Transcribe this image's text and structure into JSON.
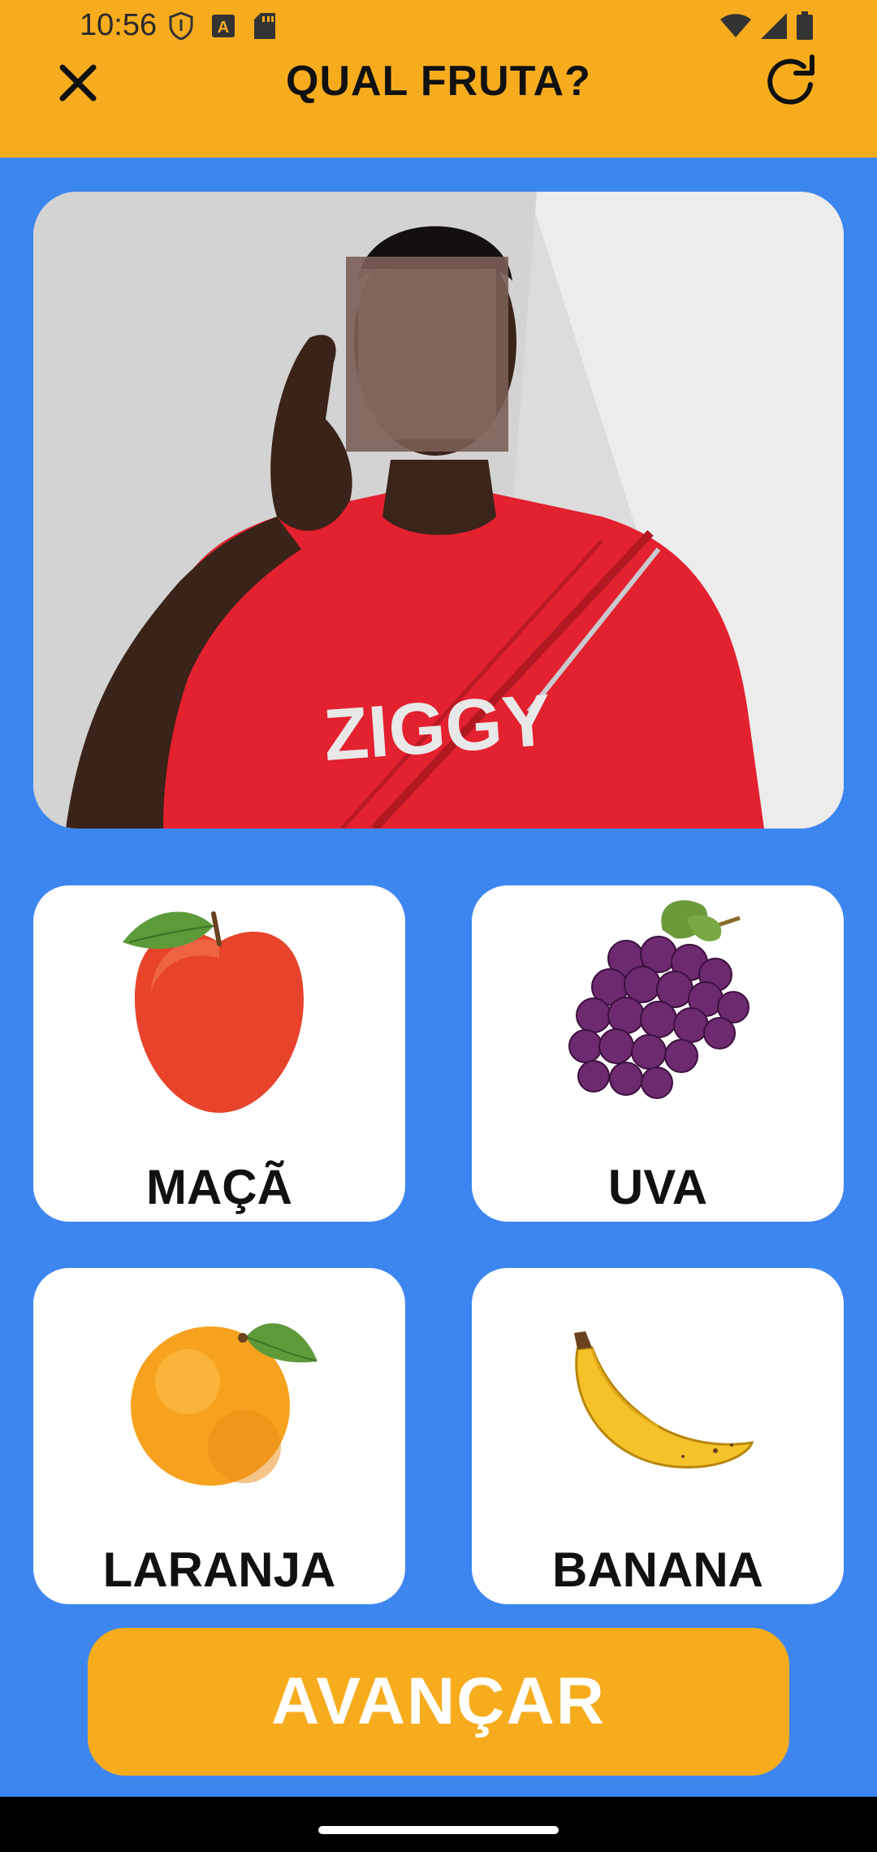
{
  "status_bar": {
    "time": "10:56",
    "icons": [
      "shield-icon",
      "font-a-icon",
      "sd-card-icon",
      "wifi-icon",
      "signal-icon",
      "battery-icon"
    ]
  },
  "header": {
    "title": "QUAL FRUTA?",
    "close_icon": "close-icon",
    "refresh_icon": "refresh-icon"
  },
  "video": {
    "shirt_text": "ZIGGY"
  },
  "options": [
    {
      "label": "MAÇÃ",
      "icon": "apple-icon"
    },
    {
      "label": "UVA",
      "icon": "grapes-icon"
    },
    {
      "label": "LARANJA",
      "icon": "orange-icon"
    },
    {
      "label": "BANANA",
      "icon": "banana-icon"
    }
  ],
  "advance_button": {
    "label": "AVANÇAR"
  },
  "colors": {
    "header_bg": "#f7ac1e",
    "page_bg": "#3d86f0",
    "card_bg": "#ffffff",
    "button_bg": "#f7ac1e"
  }
}
